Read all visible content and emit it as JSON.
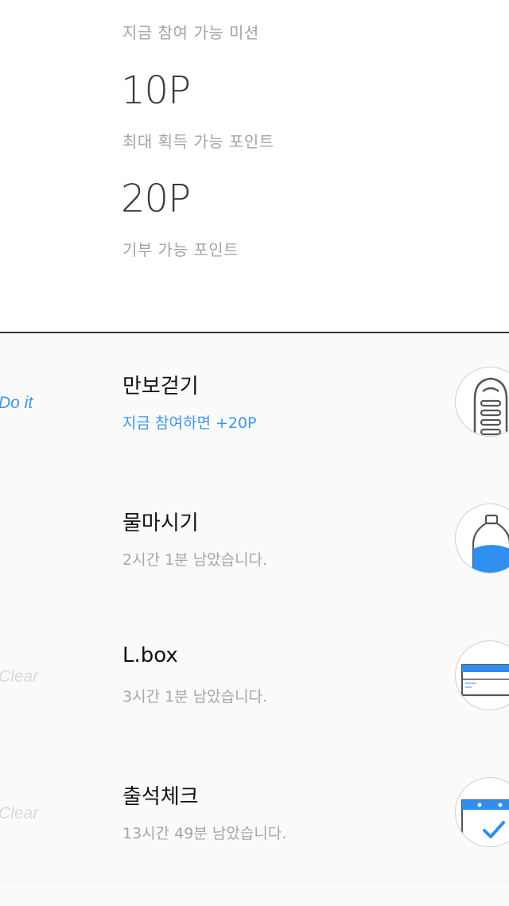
{
  "summary": {
    "available_missions_label": "지금 참여 가능 미션",
    "max_points_value": "10P",
    "max_points_label": "최대 획득 가능 포인트",
    "donate_points_value": "20P",
    "donate_points_label": "기부 가능 포인트"
  },
  "missions": [
    {
      "status": "Do it",
      "title": "만보걷기",
      "subtitle": "지금 참여하면 +20P",
      "icon": "sneaker-icon"
    },
    {
      "status": "",
      "title": "물마시기",
      "subtitle": "2시간 1분 남았습니다.",
      "icon": "water-bottle-icon"
    },
    {
      "status": "Clear",
      "title": "L.box",
      "subtitle": "3시간 1분 남았습니다.",
      "icon": "lbox-icon"
    },
    {
      "status": "Clear",
      "title": "출석체크",
      "subtitle": "13시간 49분 남았습니다.",
      "icon": "calendar-check-icon"
    }
  ],
  "colors": {
    "accent": "#3d97e8",
    "clear_gray": "#dadada",
    "divider": "#333333"
  }
}
